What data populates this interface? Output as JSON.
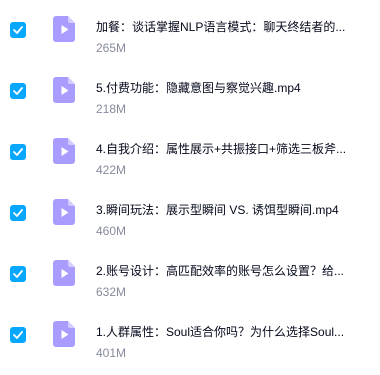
{
  "colors": {
    "checkbox": "#06a7ff",
    "video_icon": "#a89cff",
    "video_icon_fold": "#d3ccff",
    "name_text": "#03081a",
    "size_text": "#878c9c"
  },
  "files": [
    {
      "name": "加餐：谈话掌握NLP语言模式：聊天终结者的...",
      "size": "265M",
      "checked": true,
      "icon": "video-file-icon"
    },
    {
      "name": "5.付费功能：隐藏意图与察觉兴趣.mp4",
      "size": "218M",
      "checked": true,
      "icon": "video-file-icon"
    },
    {
      "name": "4.自我介绍：属性展示+共振接口+筛选三板斧...",
      "size": "422M",
      "checked": true,
      "icon": "video-file-icon"
    },
    {
      "name": "3.瞬间玩法：展示型瞬间 VS. 诱饵型瞬间.mp4",
      "size": "460M",
      "checked": true,
      "icon": "video-file-icon"
    },
    {
      "name": "2.账号设计：高匹配效率的账号怎么设置？给...",
      "size": "632M",
      "checked": true,
      "icon": "video-file-icon"
    },
    {
      "name": "1.人群属性：Soul适合你吗？为什么选择Soul...",
      "size": "401M",
      "checked": true,
      "icon": "video-file-icon"
    }
  ]
}
